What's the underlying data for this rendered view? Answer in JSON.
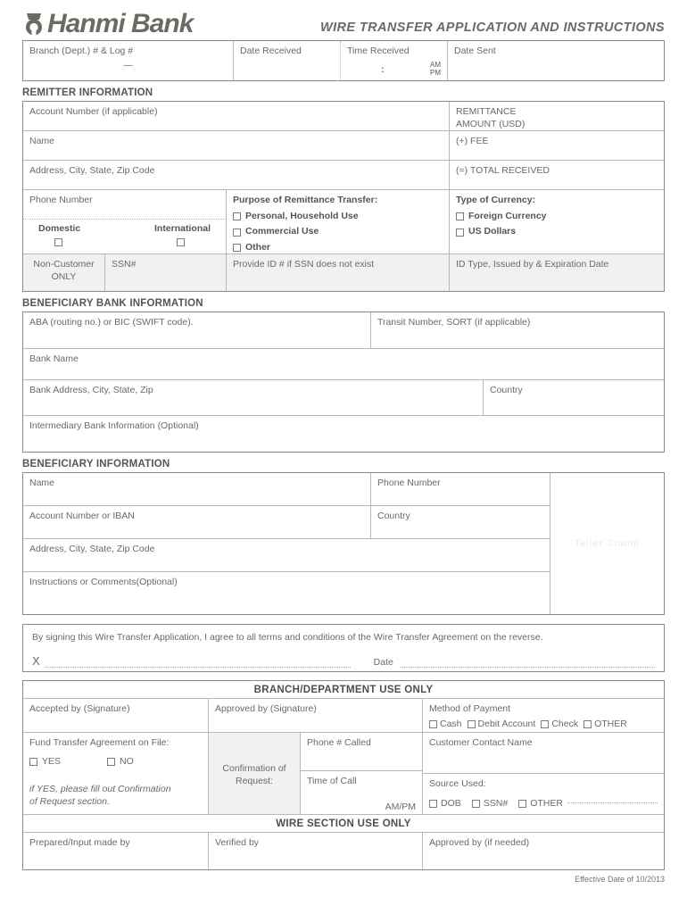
{
  "header": {
    "logo_icon": "hanmi-bank-logo-icon",
    "logo_text": "Hanmi Bank",
    "title": "WIRE TRANSFER APPLICATION AND INSTRUCTIONS"
  },
  "top_row": {
    "branch": "Branch (Dept.) # & Log #",
    "branch_value": "—",
    "date_received": "Date Received",
    "time_received": "Time Received",
    "time_colon": ":",
    "am": "AM",
    "pm": "PM",
    "date_sent": "Date Sent"
  },
  "remitter": {
    "section_title": "REMITTER INFORMATION",
    "account_number": "Account Number (if applicable)",
    "name": "Name",
    "address": "Address, City, State, Zip Code",
    "phone": "Phone Number",
    "domestic": "Domestic",
    "international": "International",
    "remittance_amount": "REMITTANCE\nAMOUNT (USD)",
    "remittance_amount_l1": "REMITTANCE",
    "remittance_amount_l2": "AMOUNT (USD)",
    "fee": "(+) FEE",
    "total_received": "(=) TOTAL RECEIVED",
    "purpose_title": "Purpose of Remittance Transfer:",
    "purpose_options": [
      "Personal, Household Use",
      "Commercial Use",
      "Other"
    ],
    "currency_title": "Type of Currency:",
    "currency_options": [
      "Foreign Currency",
      "US Dollars"
    ],
    "noncustomer_l1": "Non-Customer",
    "noncustomer_l2": "ONLY",
    "ssn": "SSN#",
    "provide_id": "Provide ID # if SSN does not exist",
    "id_type": "ID Type, Issued by & Expiration Date"
  },
  "beneficiary_bank": {
    "section_title": "BENEFICIARY BANK INFORMATION",
    "aba": "ABA (routing no.) or BIC (SWIFT code).",
    "transit": "Transit Number, SORT (if applicable)",
    "bank_name": "Bank Name",
    "bank_address": "Bank Address, City, State, Zip",
    "country": "Country",
    "intermediary": "Intermediary Bank Information (Optional)"
  },
  "beneficiary": {
    "section_title": "BENEFICIARY INFORMATION",
    "name": "Name",
    "phone": "Phone Number",
    "account_iban": "Account Number or IBAN",
    "country": "Country",
    "address": "Address, City, State, Zip Code",
    "instructions": "Instructions or Comments(Optional)",
    "teller_stamp": "Teller Stamp"
  },
  "signature": {
    "agreement_text": "By signing this Wire Transfer Application, I agree to all terms and conditions of the Wire Transfer Agreement on the reverse.",
    "x_mark": "X",
    "date_label": "Date"
  },
  "branch_use": {
    "band_title": "BRANCH/DEPARTMENT USE ONLY",
    "accepted_by": "Accepted by (Signature)",
    "approved_by": "Approved by (Signature)",
    "method_of_payment": "Method of Payment",
    "payment_options": [
      "Cash",
      "Debit Account",
      "Check",
      "OTHER"
    ],
    "fund_transfer": "Fund Transfer Agreement on File:",
    "yes": "YES",
    "no": "NO",
    "if_yes_l1": "if YES, please fill out Confirmation",
    "if_yes_l2": "of Request section.",
    "confirmation_l1": "Confirmation of",
    "confirmation_l2": "Request:",
    "phone_called": "Phone # Called",
    "customer_contact": "Customer Contact Name",
    "time_of_call": "Time of Call",
    "ampm": "AM/PM",
    "source_used": "Source Used:",
    "source_options": [
      "DOB",
      "SSN#",
      "OTHER"
    ]
  },
  "wire_use": {
    "band_title": "WIRE SECTION USE ONLY",
    "prepared_by": "Prepared/Input made by",
    "verified_by": "Verified by",
    "approved_by": "Approved by (if needed)"
  },
  "footer": {
    "effective_date": "Effective Date of 10/2013"
  },
  "colors": {
    "ink": "#6a6a64",
    "rule": "#b9b9b4",
    "frame": "#8a8a84",
    "shade": "#f1f1f0"
  }
}
